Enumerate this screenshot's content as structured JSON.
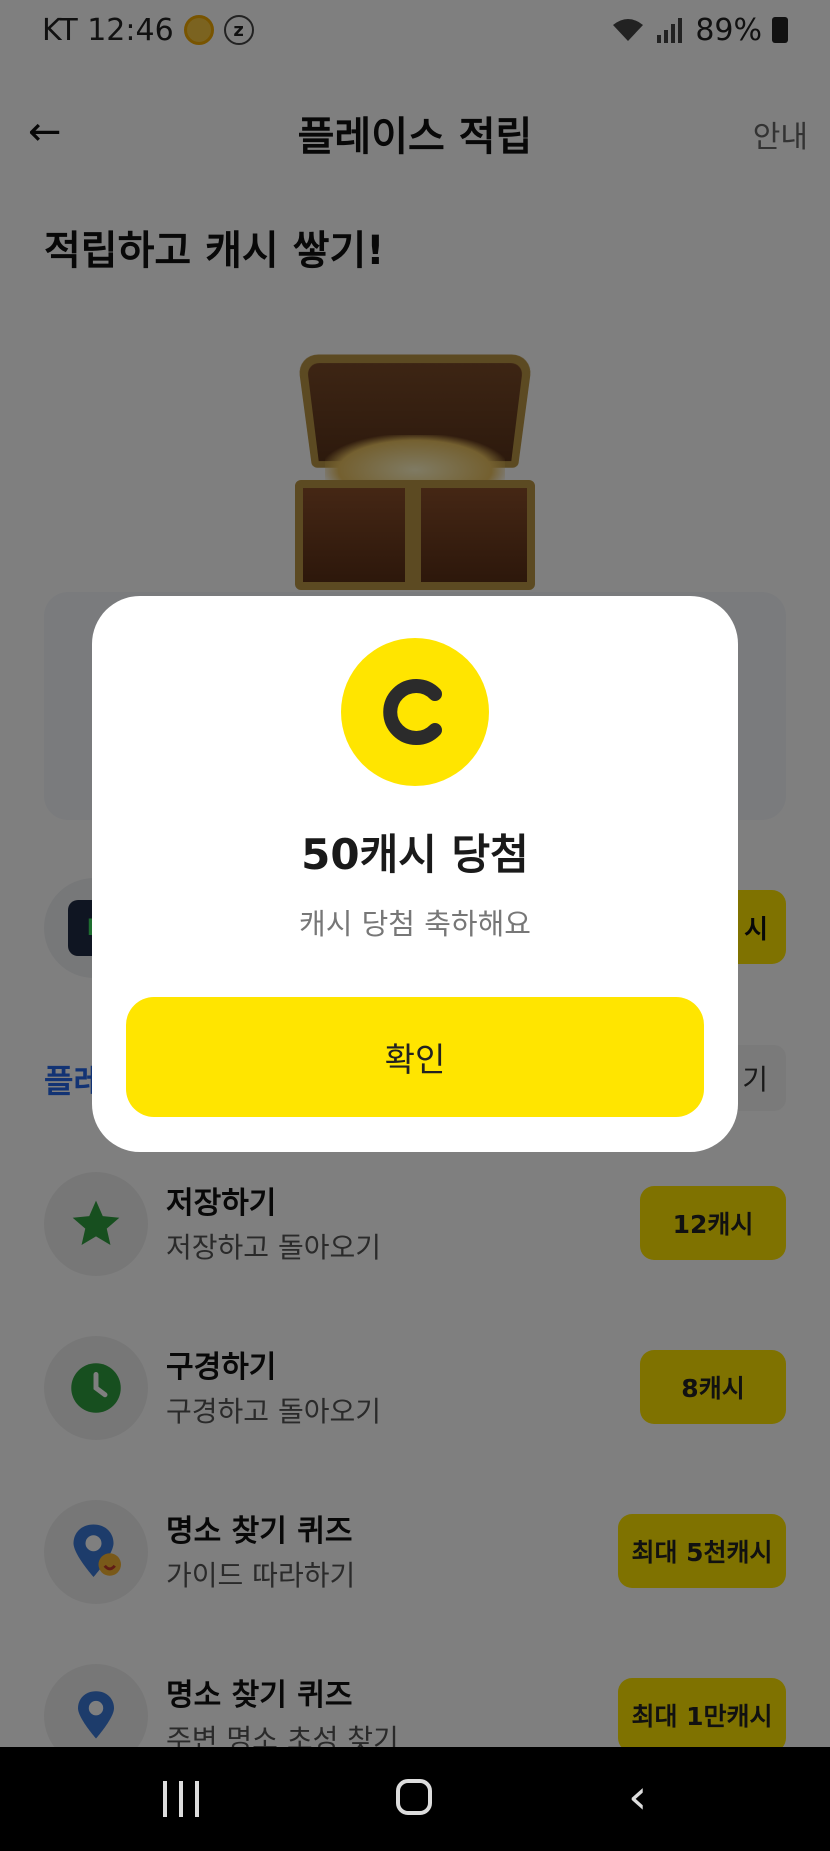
{
  "status_bar": {
    "carrier_time": "KT 12:46",
    "battery": "89%",
    "z_icon_label": "z"
  },
  "header": {
    "back_label": "←",
    "title": "플레이스 적립",
    "help": "안내"
  },
  "hero": {
    "title": "적립하고 캐시 쌓기!"
  },
  "notice": {
    "badge": "N",
    "button": "시"
  },
  "section": {
    "label": "플레",
    "more": "기"
  },
  "missions": [
    {
      "title": "저장하기",
      "subtitle": "저장하고 돌아오기",
      "reward": "12캐시",
      "icon": "star-icon"
    },
    {
      "title": "구경하기",
      "subtitle": "구경하고 돌아오기",
      "reward": "8캐시",
      "icon": "clock-icon"
    },
    {
      "title": "명소 찾기 퀴즈",
      "subtitle": "가이드 따라하기",
      "reward": "최대 5천캐시",
      "icon": "map-pin-smile-icon"
    },
    {
      "title": "명소 찾기 퀴즈",
      "subtitle": "주변 명소 초성 찾기",
      "reward": "최대 1만캐시",
      "icon": "map-pin-icon"
    }
  ],
  "modal": {
    "coin_letter": "C",
    "title": "50캐시 당첨",
    "subtitle": "캐시 당첨 축하해요",
    "confirm": "확인"
  },
  "colors": {
    "accent_yellow": "#ffe500",
    "link_blue": "#2467e8",
    "star_green": "#2e9e3e"
  }
}
